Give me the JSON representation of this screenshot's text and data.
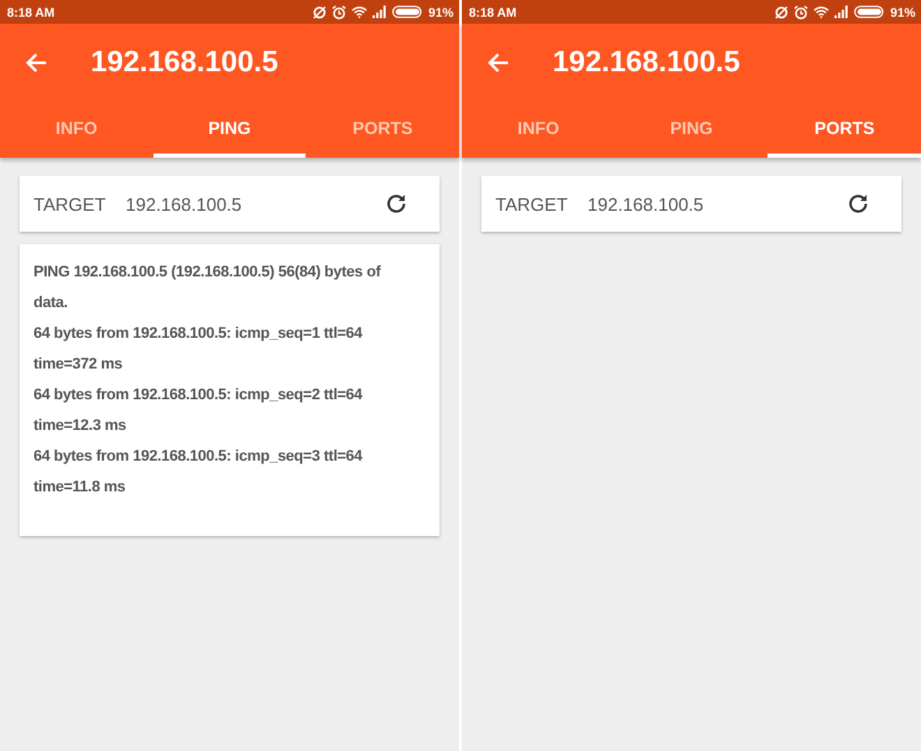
{
  "screens": [
    {
      "status_bar": {
        "time": "8:18 AM",
        "battery": "91%"
      },
      "title": "192.168.100.5",
      "tabs": [
        {
          "label": "INFO",
          "selected": false
        },
        {
          "label": "PING",
          "selected": true
        },
        {
          "label": "PORTS",
          "selected": false
        }
      ],
      "target": {
        "label": "TARGET",
        "value": "192.168.100.5"
      },
      "output": [
        "PING 192.168.100.5 (192.168.100.5) 56(84) bytes of",
        "data.",
        "64 bytes from 192.168.100.5: icmp_seq=1 ttl=64",
        "time=372 ms",
        "64 bytes from 192.168.100.5: icmp_seq=2 ttl=64",
        "time=12.3 ms",
        "64 bytes from 192.168.100.5: icmp_seq=3 ttl=64",
        "time=11.8 ms"
      ]
    },
    {
      "status_bar": {
        "time": "8:18 AM",
        "battery": "91%"
      },
      "title": "192.168.100.5",
      "tabs": [
        {
          "label": "INFO",
          "selected": false
        },
        {
          "label": "PING",
          "selected": false
        },
        {
          "label": "PORTS",
          "selected": true
        }
      ],
      "target": {
        "label": "TARGET",
        "value": "192.168.100.5"
      }
    }
  ]
}
